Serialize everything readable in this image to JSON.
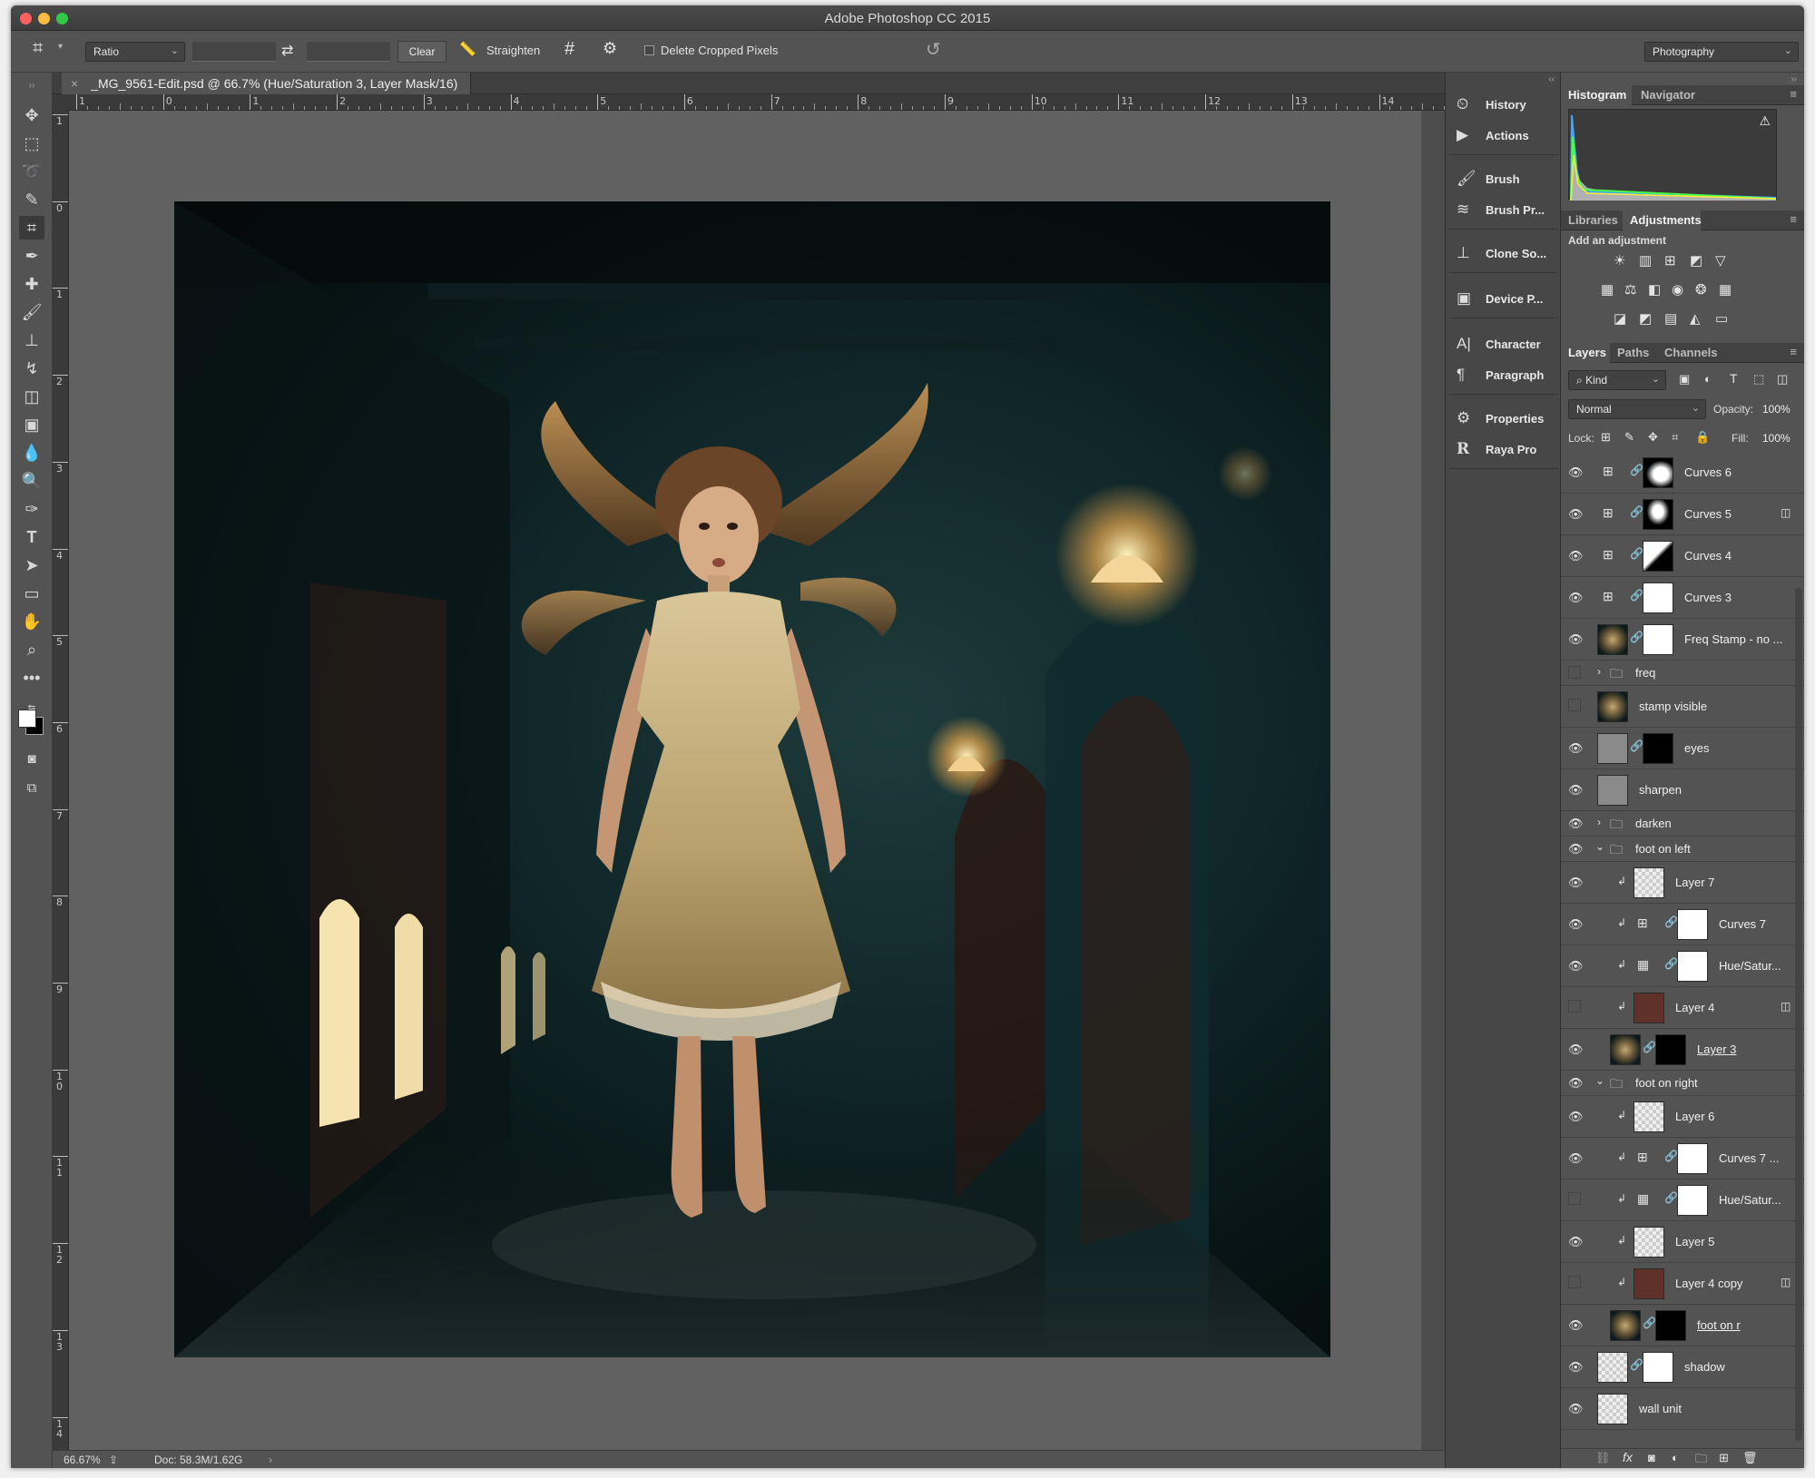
{
  "app": {
    "title": "Adobe Photoshop CC 2015"
  },
  "options_bar": {
    "ratio": "Ratio",
    "clear": "Clear",
    "straighten": "Straighten",
    "delete_cropped": "Delete Cropped Pixels",
    "workspace": "Photography"
  },
  "document": {
    "tab": "_MG_9561-Edit.psd @ 66.7% (Hue/Saturation 3, Layer Mask/16)",
    "zoom": "66.67%",
    "doc_size": "Doc: 58.3M/1.62G"
  },
  "ruler": {
    "h_ticks": [
      "1",
      "0",
      "1",
      "2",
      "3",
      "4",
      "5",
      "6",
      "7",
      "8",
      "9",
      "10",
      "11",
      "12",
      "13",
      "14"
    ],
    "v_ticks": [
      "1",
      "0",
      "1",
      "2",
      "3",
      "4",
      "5",
      "6",
      "7",
      "8",
      "9",
      "1\n0",
      "1\n1",
      "1\n2",
      "1\n3",
      "1\n4"
    ]
  },
  "dock": {
    "items": [
      "History",
      "Actions",
      "Brush",
      "Brush Pr...",
      "Clone So...",
      "Device P...",
      "Character",
      "Paragraph",
      "Properties",
      "Raya Pro"
    ]
  },
  "histogram": {
    "tabs": [
      "Histogram",
      "Navigator"
    ]
  },
  "adjustments": {
    "tabs": [
      "Libraries",
      "Adjustments"
    ],
    "hint": "Add an adjustment"
  },
  "layers_panel": {
    "tabs": [
      "Layers",
      "Paths",
      "Channels"
    ],
    "filter": "Kind",
    "blend_mode": "Normal",
    "opacity_label": "Opacity:",
    "opacity": "100%",
    "lock_label": "Lock:",
    "fill_label": "Fill:",
    "fill": "100%"
  },
  "layers": [
    {
      "name": "Curves 6"
    },
    {
      "name": "Curves 5"
    },
    {
      "name": "Curves 4"
    },
    {
      "name": "Curves 3"
    },
    {
      "name": "Freq Stamp - no ..."
    },
    {
      "name": "freq"
    },
    {
      "name": "stamp visible"
    },
    {
      "name": "eyes"
    },
    {
      "name": "sharpen"
    },
    {
      "name": "darken"
    },
    {
      "name": "foot on left"
    },
    {
      "name": "Layer 7"
    },
    {
      "name": "Curves 7"
    },
    {
      "name": "Hue/Satur..."
    },
    {
      "name": "Layer 4"
    },
    {
      "name": "Layer 3"
    },
    {
      "name": "foot on right"
    },
    {
      "name": "Layer 6"
    },
    {
      "name": "Curves 7 ..."
    },
    {
      "name": "Hue/Satur..."
    },
    {
      "name": "Layer 5"
    },
    {
      "name": "Layer 4 copy"
    },
    {
      "name": "foot on r"
    },
    {
      "name": "shadow"
    },
    {
      "name": "wall unit"
    }
  ]
}
